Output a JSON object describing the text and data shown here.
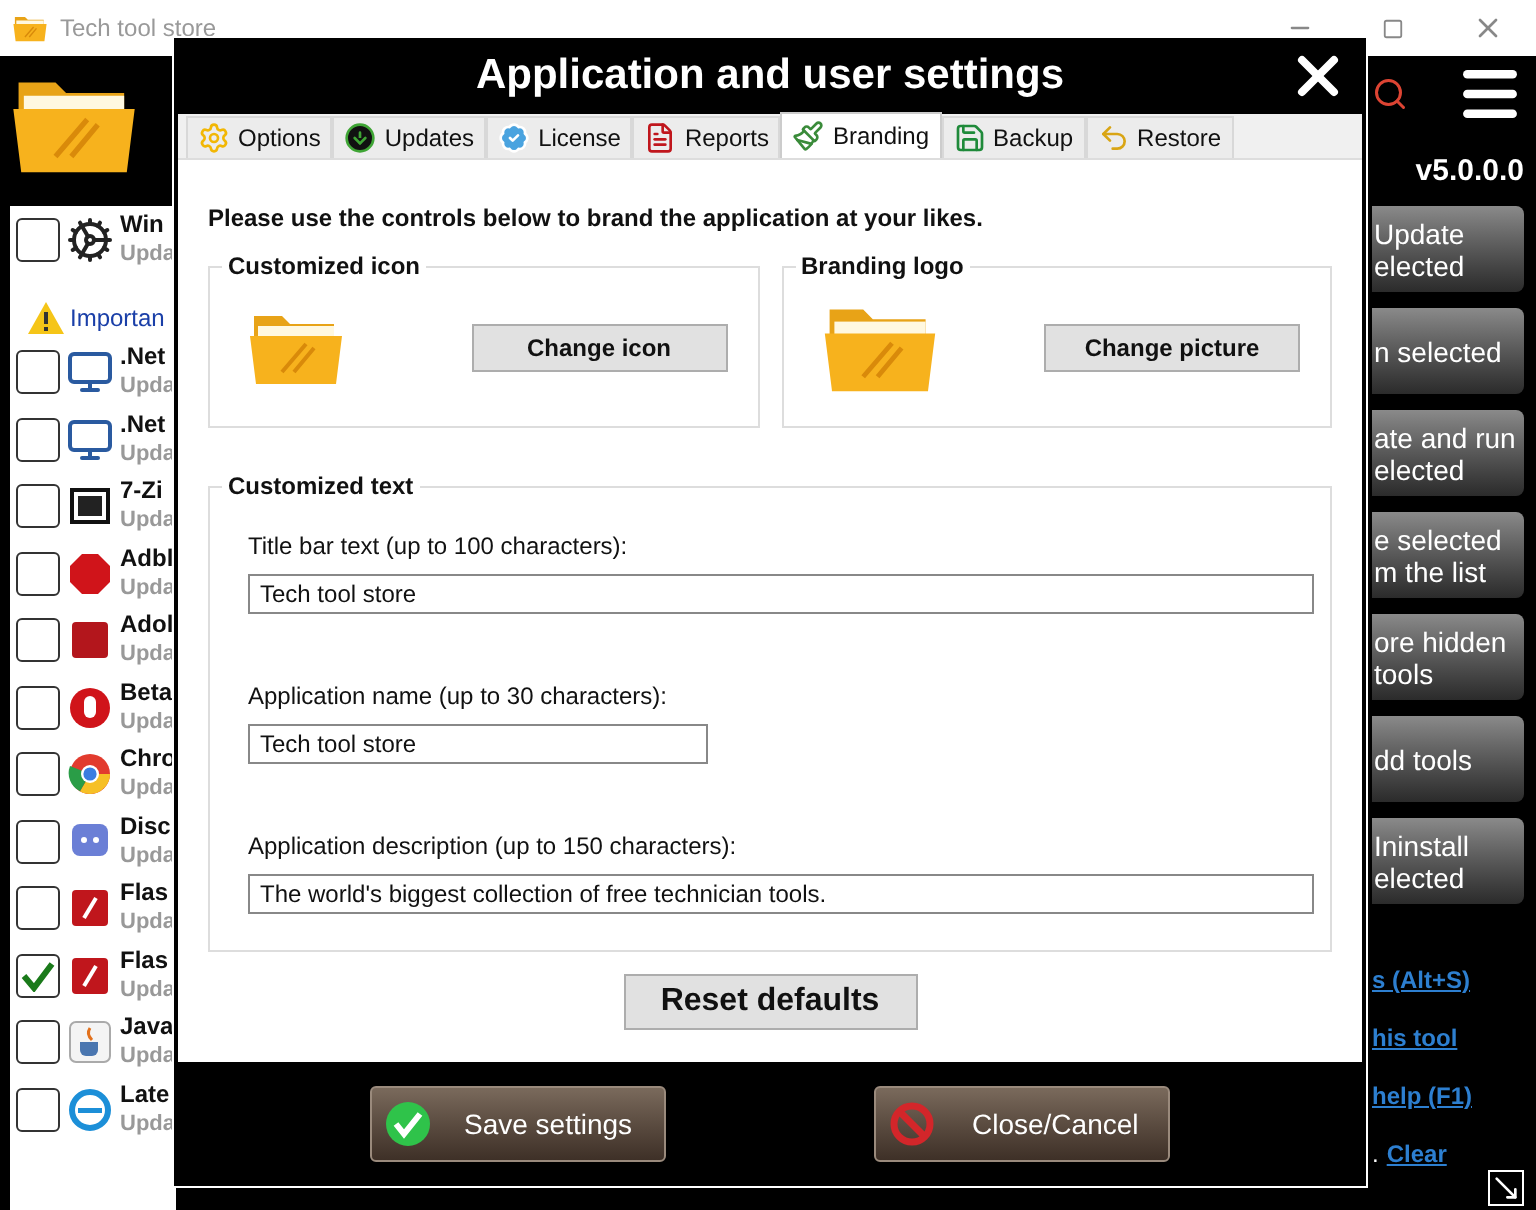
{
  "window": {
    "title": "Tech tool store"
  },
  "app": {
    "version": "v5.0.0.0"
  },
  "tool_list": [
    {
      "kind": "tool",
      "name": "Win",
      "status": "Upda",
      "checked": false
    },
    {
      "kind": "notice",
      "text": "Importan"
    },
    {
      "kind": "tool",
      "name": ".Net",
      "status": "Upda",
      "checked": false
    },
    {
      "kind": "tool",
      "name": ".Net",
      "status": "Upda",
      "checked": false
    },
    {
      "kind": "tool",
      "name": "7-Zi",
      "status": "Upda",
      "checked": false
    },
    {
      "kind": "tool",
      "name": "Adbl",
      "status": "Upda",
      "checked": false
    },
    {
      "kind": "tool",
      "name": "Adol",
      "status": "Upda",
      "checked": false
    },
    {
      "kind": "tool",
      "name": "Beta",
      "status": "Upda",
      "checked": false
    },
    {
      "kind": "tool",
      "name": "Chro",
      "status": "Upda",
      "checked": false
    },
    {
      "kind": "tool",
      "name": "Disc",
      "status": "Upda",
      "checked": false
    },
    {
      "kind": "tool",
      "name": "Flas",
      "status": "Upda",
      "checked": false
    },
    {
      "kind": "tool",
      "name": "Flas",
      "status": "Upda",
      "checked": true
    },
    {
      "kind": "tool",
      "name": "Java",
      "status": "Upda",
      "checked": false
    },
    {
      "kind": "tool",
      "name": "Late",
      "status": "Upda",
      "checked": false
    }
  ],
  "side_actions": [
    {
      "label": "Update\nelected"
    },
    {
      "label": "n selected"
    },
    {
      "label": "ate and run\nelected"
    },
    {
      "label": "e selected\nm the list"
    },
    {
      "label": "ore hidden\n tools"
    },
    {
      "label": "dd tools"
    },
    {
      "label": "Ininstall\nelected"
    }
  ],
  "side_links": [
    {
      "text": "s (Alt+S)"
    },
    {
      "text": "his tool"
    },
    {
      "text": "help (F1)"
    },
    {
      "prefix": ".",
      "text": "Clear"
    }
  ],
  "dialog": {
    "title": "Application and user settings",
    "tabs": [
      {
        "label": "Options",
        "selected": false
      },
      {
        "label": "Updates",
        "selected": false
      },
      {
        "label": "License",
        "selected": false
      },
      {
        "label": "Reports",
        "selected": false
      },
      {
        "label": "Branding",
        "selected": true
      },
      {
        "label": "Backup",
        "selected": false
      },
      {
        "label": "Restore",
        "selected": false
      }
    ],
    "intro": "Please use the controls below to brand the application at your likes.",
    "groups": [
      {
        "title": "Customized icon",
        "button": "Change icon"
      },
      {
        "title": "Branding logo",
        "button": "Change picture"
      }
    ],
    "text_group": {
      "title": "Customized text",
      "fields": [
        {
          "label": "Title bar text (up to 100 characters):",
          "value": "Tech tool store",
          "kind": "wide"
        },
        {
          "label": "Application name (up to 30 characters):",
          "value": "Tech tool store",
          "kind": "narrow"
        },
        {
          "label": "Application description (up to 150 characters):",
          "value": "The world's biggest collection of free technician tools.",
          "kind": "wide"
        }
      ]
    },
    "reset_button": "Reset defaults",
    "save_button": "Save settings",
    "cancel_button": "Close/Cancel"
  }
}
